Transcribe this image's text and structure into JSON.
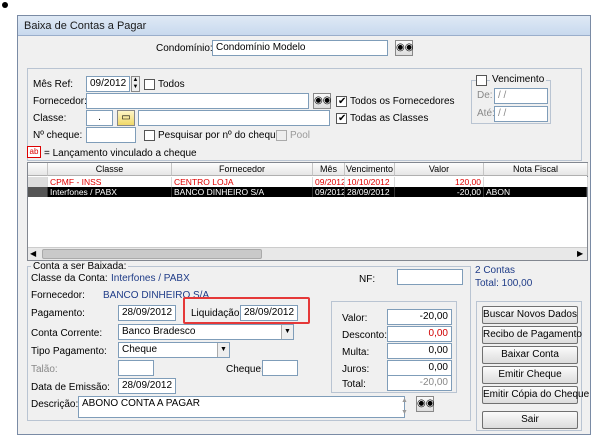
{
  "window": {
    "title": "Baixa de Contas a Pagar"
  },
  "condominio": {
    "label": "Condomínio:",
    "value": "Condomínio Modelo"
  },
  "filters": {
    "mes_ref_label": "Mês Ref:",
    "mes_ref_value": "09/2012",
    "todos_label": "Todos",
    "fornecedor_label": "Fornecedor:",
    "classe_label": "Classe:",
    "classe_value": ".",
    "nr_cheque_label": "Nº cheque:",
    "todos_fornecedores_label": "Todos os Fornecedores",
    "todas_classes_label": "Todas as Classes",
    "pesquisar_cheque_label": "Pesquisar por nº do cheque",
    "pool_label": "Pool",
    "vencimento_label": "Vencimento",
    "de_label": "De:",
    "ate_label": "Até:",
    "de_value": " / /",
    "ate_value": " / /"
  },
  "legend": {
    "badge": "ab",
    "text": "= Lançamento vinculado a cheque"
  },
  "table": {
    "columns": [
      "Classe",
      "Fornecedor",
      "Mês",
      "Vencimento",
      "Valor",
      "Nota Fiscal"
    ],
    "rows": [
      [
        "CPMF - INSS",
        "CENTRO LOJA",
        "09/2012",
        "10/10/2012",
        "120,00",
        ""
      ],
      [
        "Interfones / PABX",
        "BANCO DINHEIRO S/A",
        "09/2012",
        "28/09/2012",
        "-20,00",
        "ABON"
      ]
    ]
  },
  "summary": {
    "contas": "2 Contas",
    "total": "Total: 100,00"
  },
  "conta": {
    "group_label": "Conta a ser Baixada:",
    "classe_label": "Classe da Conta:",
    "classe_value": "Interfones / PABX",
    "fornecedor_label": "Fornecedor:",
    "fornecedor_value": "BANCO DINHEIRO S/A",
    "nf_label": "NF:",
    "pagamento_label": "Pagamento:",
    "pagamento_value": "28/09/2012",
    "liquidacao_label": "Liquidação:",
    "liquidacao_value": "28/09/2012",
    "conta_corrente_label": "Conta Corrente:",
    "conta_corrente_value": "Banco Bradesco",
    "tipo_pagamento_label": "Tipo Pagamento:",
    "tipo_pagamento_value": "Cheque",
    "talao_label": "Talão:",
    "cheque_label": "Cheque:",
    "data_emissao_label": "Data de Emissão:",
    "data_emissao_value": "28/09/2012",
    "descricao_label": "Descrição:",
    "descricao_value": "ABONO CONTA A PAGAR"
  },
  "valores": {
    "valor_label": "Valor:",
    "valor": "-20,00",
    "desconto_label": "Desconto:",
    "desconto": "0,00",
    "multa_label": "Multa:",
    "multa": "0,00",
    "juros_label": "Juros:",
    "juros": "0,00",
    "total_label": "Total:",
    "total": "-20,00"
  },
  "buttons": {
    "buscar": "Buscar Novos Dados",
    "recibo": "Recibo de Pagamento",
    "baixar": "Baixar Conta",
    "emitir_cheque": "Emitir Cheque",
    "emitir_copia": "Emitir Cópia do Cheque",
    "sair": "Sair"
  },
  "colors": {
    "selected_row": "#000000",
    "red_text": "#d00000",
    "highlight": "#e53838",
    "blue_text": "#1f3c88"
  }
}
